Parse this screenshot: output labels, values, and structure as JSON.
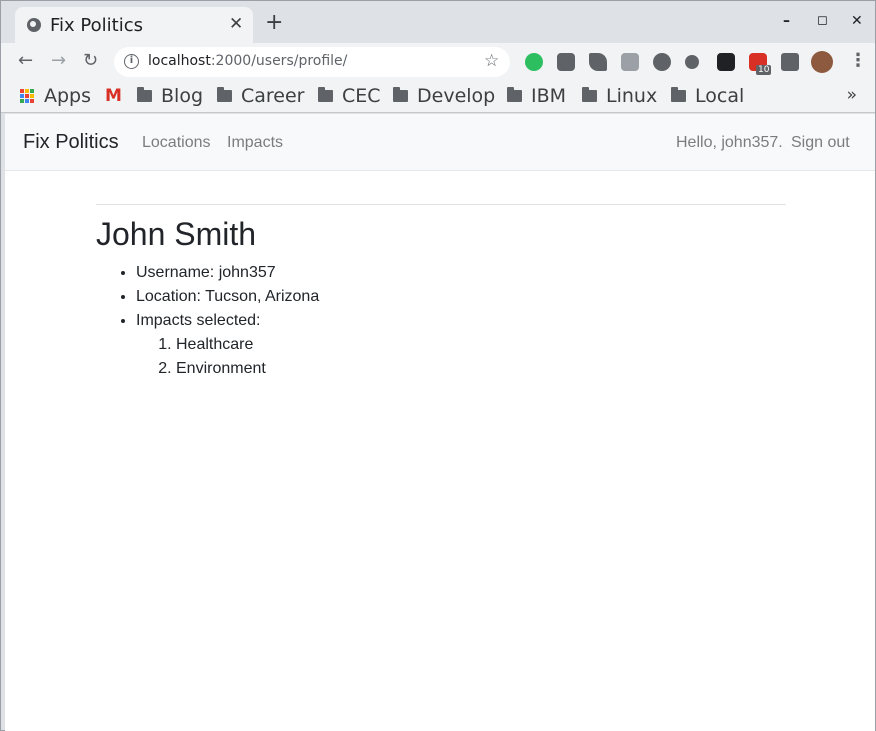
{
  "browser": {
    "tab_title": "Fix Politics",
    "tab_close": "✕",
    "new_tab": "+",
    "window_controls": {
      "minimize": "–",
      "maximize": "◻",
      "close": "✕"
    },
    "url_host": "localhost",
    "url_path": ":2000/users/profile/",
    "extension_badge": "10",
    "bookmarks": {
      "apps": "Apps",
      "gmail_icon": "M",
      "folders": [
        "Blog",
        "Career",
        "CEC",
        "Develop",
        "IBM",
        "Linux",
        "Local"
      ],
      "more": "»"
    }
  },
  "navbar": {
    "brand": "Fix Politics",
    "links": [
      "Locations",
      "Impacts"
    ],
    "greeting": "Hello, john357.",
    "signout": "Sign out"
  },
  "profile": {
    "name": "John Smith",
    "username": "Username: john357",
    "location": "Location: Tucson, Arizona",
    "impacts_label": "Impacts selected:",
    "impacts": [
      "Healthcare",
      "Environment"
    ]
  },
  "colors": {
    "chrome_bg": "#dee1e6",
    "toolbar_bg": "#f1f3f4",
    "navbar_bg": "#f8f9fa",
    "text": "#212529",
    "muted_link": "#7a7d80"
  }
}
